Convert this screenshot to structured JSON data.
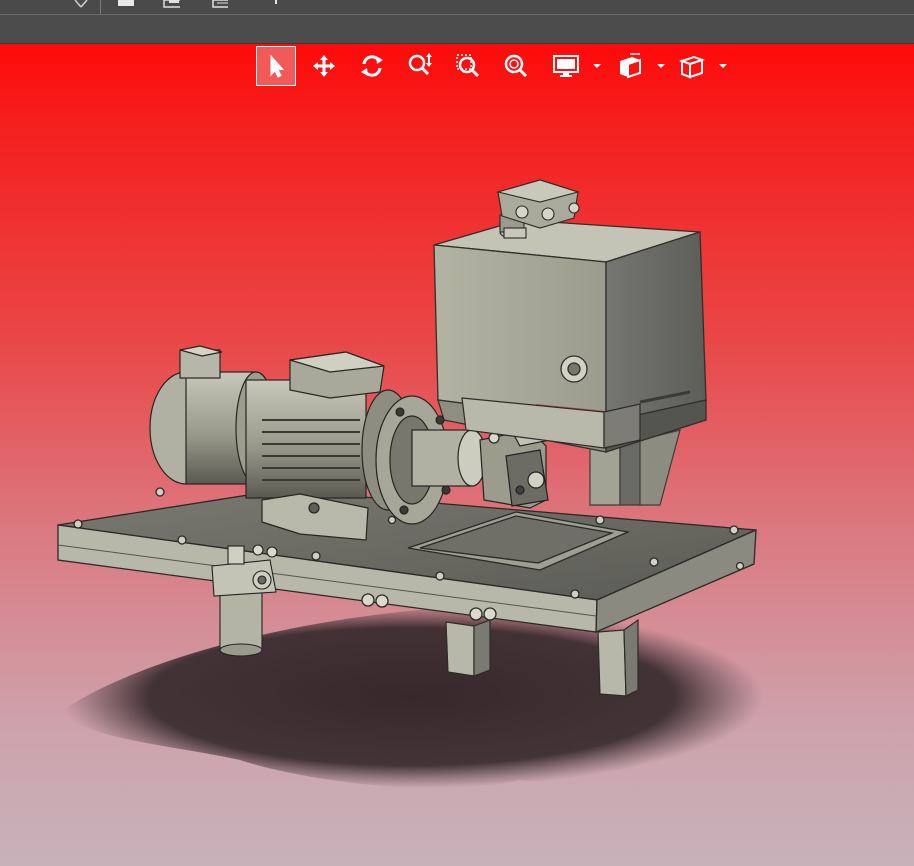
{
  "window": {
    "topbar_icons": [
      "cut-icon",
      "save-icon",
      "print-icon",
      "pin-icon"
    ]
  },
  "colors": {
    "viewport_top": "#ff0a0a",
    "viewport_bottom": "#c7b2ba",
    "model_metal": "#a8a89a",
    "toolbar_icon": "#ffffff",
    "chrome_dark": "#4a4a4a"
  },
  "view_toolbar": {
    "tools": [
      {
        "id": "select",
        "icon": "cursor-arrow-icon",
        "active": true
      },
      {
        "id": "pan",
        "icon": "move-arrows-icon",
        "active": false
      },
      {
        "id": "rotate",
        "icon": "rotate-icon",
        "active": false
      },
      {
        "id": "zoom-dynamic",
        "icon": "zoom-dynamic-icon",
        "active": false
      },
      {
        "id": "zoom-window",
        "icon": "zoom-window-icon",
        "active": false
      },
      {
        "id": "zoom-fit",
        "icon": "zoom-fit-icon",
        "active": false
      },
      {
        "id": "display-mode",
        "icon": "monitor-icon",
        "dropdown": true
      },
      {
        "id": "view-orientation",
        "icon": "cube-views-icon",
        "dropdown": true
      },
      {
        "id": "render-style",
        "icon": "cube-outline-icon",
        "dropdown": true
      }
    ]
  },
  "model": {
    "name_icon": "hydraulic-power-unit-icon",
    "parts": [
      "base-plate",
      "electric-motor",
      "coupling-bell-housing",
      "hydraulic-pump",
      "oil-tank",
      "tank-cover-filter",
      "return-filter",
      "support-legs",
      "shadow"
    ]
  }
}
